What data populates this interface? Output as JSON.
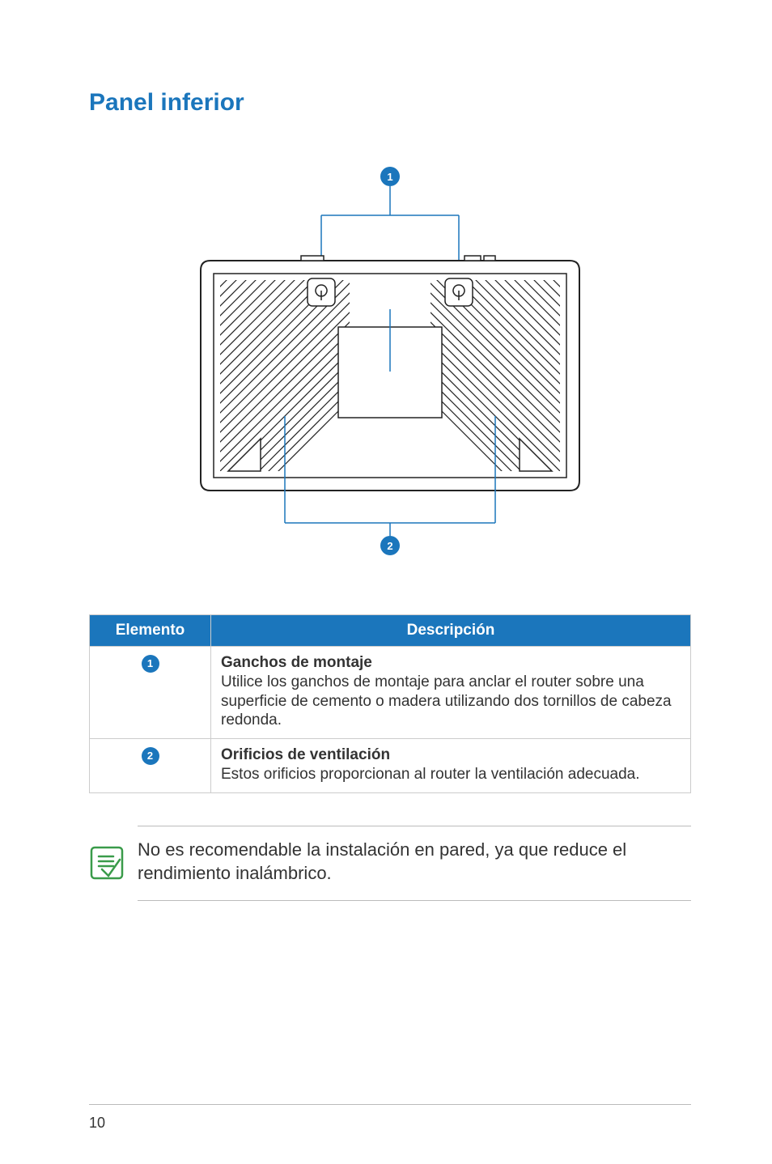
{
  "title": "Panel inferior",
  "diagram": {
    "callout_top": "1",
    "callout_bottom": "2"
  },
  "table": {
    "headers": {
      "element": "Elemento",
      "description": "Descripción"
    },
    "rows": [
      {
        "badge": "1",
        "title": "Ganchos de montaje",
        "body": "Utilice los ganchos de montaje para anclar el router sobre una superficie de cemento o madera utilizando dos tornillos de cabeza redonda."
      },
      {
        "badge": "2",
        "title": "Orificios de ventilación",
        "body": "Estos orificios proporcionan al router la ventilación adecuada."
      }
    ]
  },
  "note": "No es recomendable la instalación en pared, ya que reduce el rendimiento inalámbrico.",
  "page_number": "10"
}
